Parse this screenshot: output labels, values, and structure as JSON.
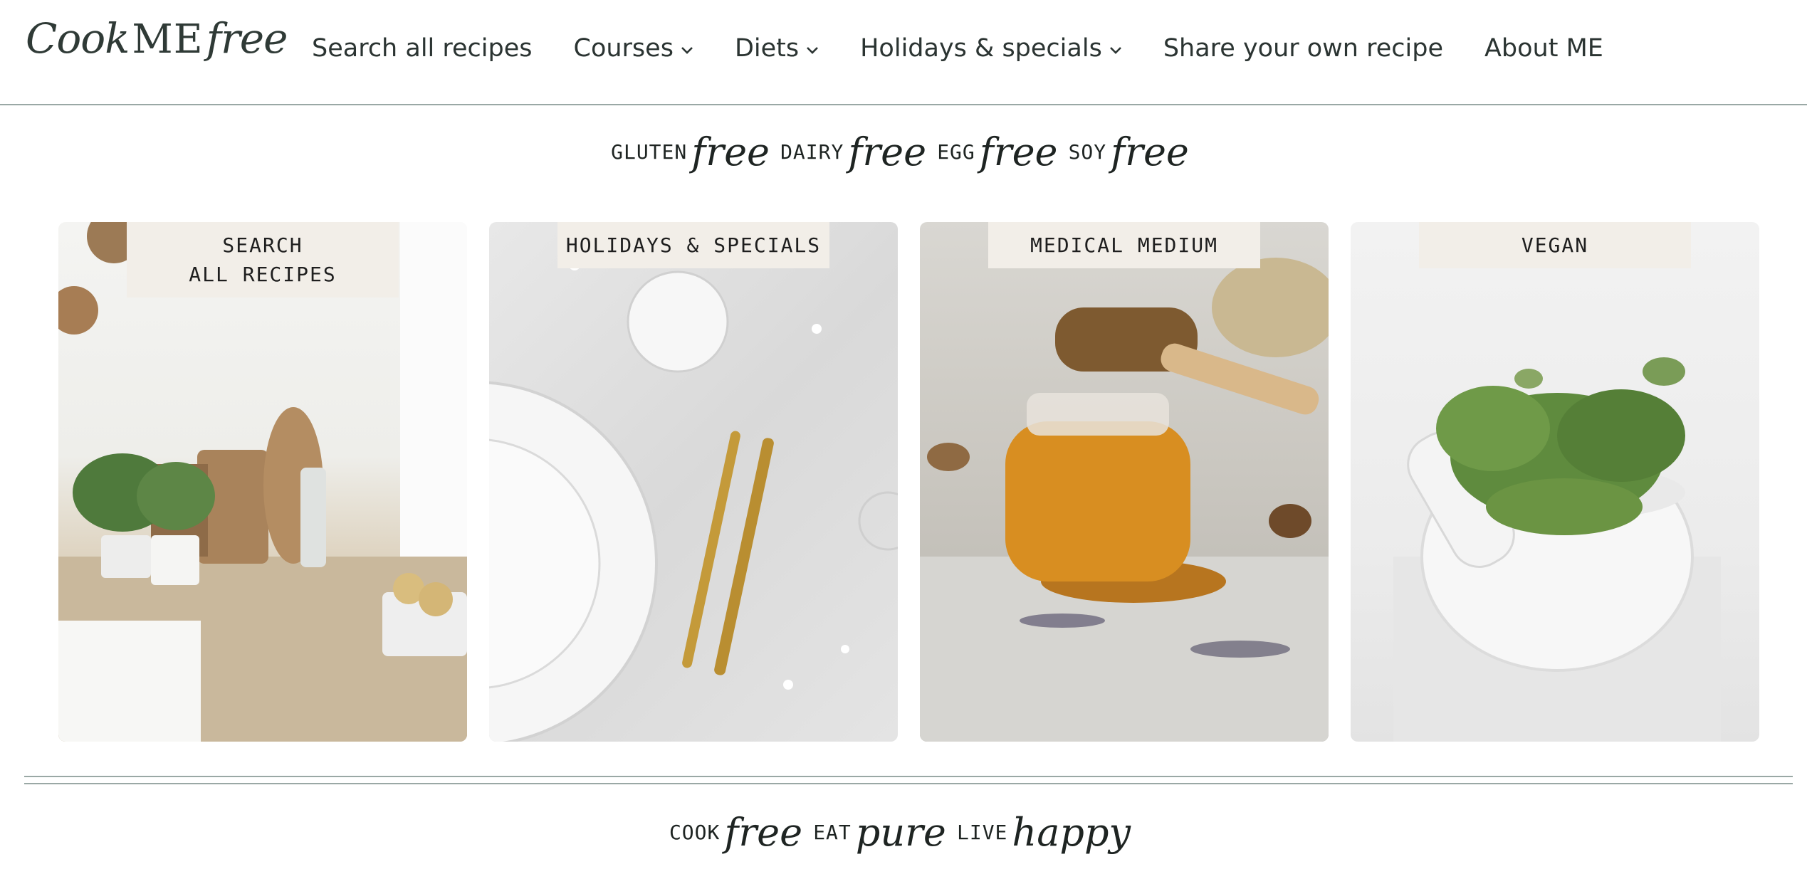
{
  "logo": {
    "part1": "Cook",
    "part2": "ME",
    "part3": "free"
  },
  "nav": [
    {
      "label": "Search all recipes",
      "dropdown": false
    },
    {
      "label": "Courses",
      "dropdown": true
    },
    {
      "label": "Diets",
      "dropdown": true
    },
    {
      "label": "Holidays & specials",
      "dropdown": true
    },
    {
      "label": "Share your own recipe",
      "dropdown": false
    },
    {
      "label": "About ME",
      "dropdown": false
    }
  ],
  "tagline_top": [
    {
      "word": "GLUTEN",
      "script": "free"
    },
    {
      "word": "DAIRY",
      "script": "free"
    },
    {
      "word": "EGG",
      "script": "free"
    },
    {
      "word": "SOY",
      "script": "free"
    }
  ],
  "cards": [
    {
      "lines": [
        "SEARCH",
        "ALL RECIPES"
      ],
      "image": "kitchen-counter-photo"
    },
    {
      "lines": [
        "HOLIDAYS & SPECIALS"
      ],
      "image": "plates-gold-cutlery-photo"
    },
    {
      "lines": [
        "MEDICAL MEDIUM"
      ],
      "image": "honey-jar-photo"
    },
    {
      "lines": [
        "VEGAN"
      ],
      "image": "herbs-mortar-photo"
    }
  ],
  "tagline_bottom": [
    {
      "word": "COOK",
      "script": "free"
    },
    {
      "word": "EAT",
      "script": "pure"
    },
    {
      "word": "LIVE",
      "script": "happy"
    }
  ],
  "colors": {
    "accent_brown": "#8a5a34",
    "label_bg": "#f2eee8",
    "rule": "#9aa8a5"
  }
}
